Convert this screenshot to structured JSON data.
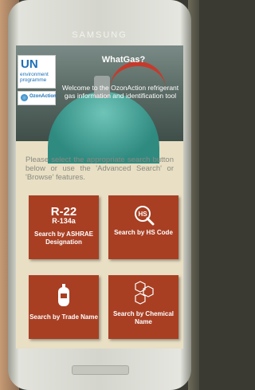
{
  "device": {
    "brand": "SAMSUNG"
  },
  "header": {
    "app_title": "WhatGas?",
    "welcome": "Welcome to the OzonAction refrigerant gas information and identification tool",
    "logos": {
      "un": "UN",
      "un_sub": "environment programme",
      "ozon": "OzonAction"
    }
  },
  "intro": "Please select the appropriate search button below or use the 'Advanced Search' or 'Browse' features.",
  "tiles": [
    {
      "badge1": "R-22",
      "badge2": "R-134a",
      "label": "Search by ASHRAE Designation"
    },
    {
      "icon": "hs-search-icon",
      "icon_text": "HS",
      "label": "Search by HS Code"
    },
    {
      "icon": "cylinder-icon",
      "label": "Search by Trade Name"
    },
    {
      "icon": "molecule-icon",
      "label": "Search by Chemical Name"
    }
  ]
}
